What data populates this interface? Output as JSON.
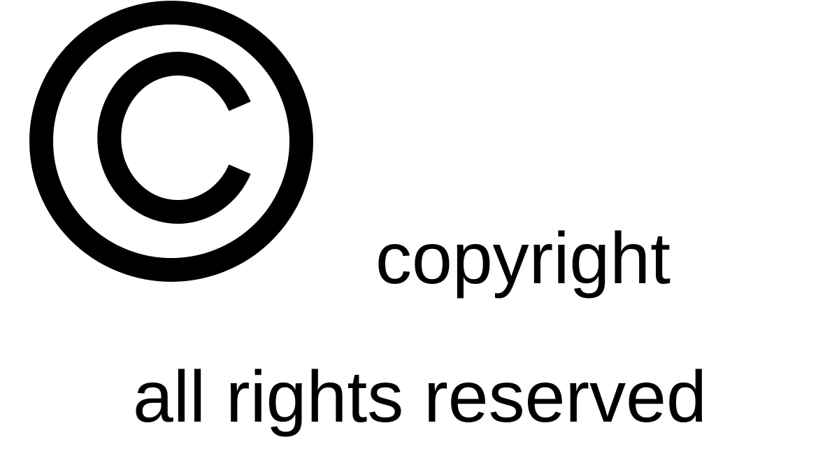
{
  "symbol": {
    "icon": "copyright-icon",
    "color": "#000000"
  },
  "text": {
    "line1": "copyright",
    "line2": "all rights reserved"
  },
  "colors": {
    "background": "#ffffff",
    "foreground": "#000000"
  }
}
